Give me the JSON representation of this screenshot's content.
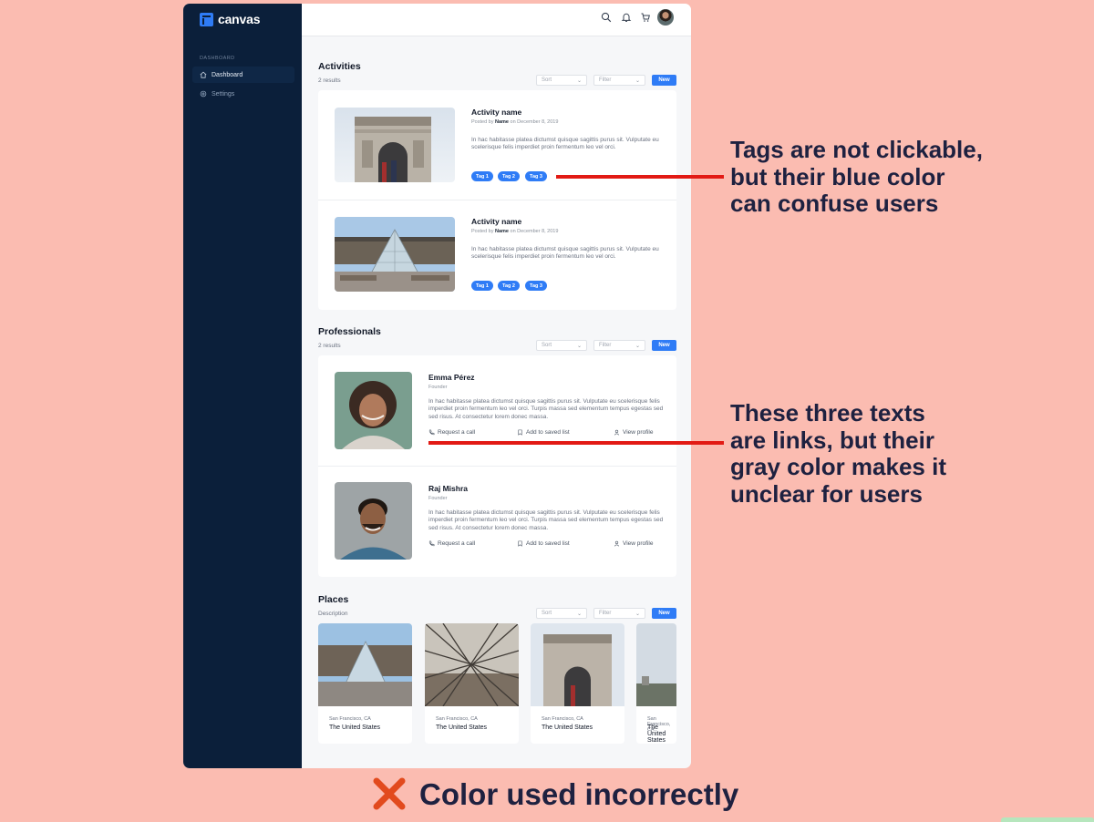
{
  "app": {
    "logo": "canvas",
    "nav_section": "DASHBOARD",
    "nav_items": [
      {
        "label": "Dashboard",
        "active": true,
        "icon": "home-icon"
      },
      {
        "label": "Settings",
        "active": false,
        "icon": "gear-icon"
      }
    ],
    "top_icons": [
      "search-icon",
      "bell-icon",
      "cart-icon",
      "avatar"
    ]
  },
  "controls": {
    "sort": "Sort",
    "filter": "Filter",
    "new": "New"
  },
  "activities": {
    "title": "Activities",
    "count": "2 results",
    "items": [
      {
        "title": "Activity name",
        "posted_by": "Posted by",
        "author": "Name",
        "date_prefix": "on",
        "date": "December 8, 2019",
        "body": "In hac habitasse platea dictumst quisque sagittis purus sit. Vulputate eu scelerisque felis imperdiet proin fermentum leo vel orci.",
        "tags": [
          "Tag 1",
          "Tag 2",
          "Tag 3"
        ],
        "image": "arc-de-triomphe"
      },
      {
        "title": "Activity name",
        "posted_by": "Posted by",
        "author": "Name",
        "date_prefix": "on",
        "date": "December 8, 2019",
        "body": "In hac habitasse platea dictumst quisque sagittis purus sit. Vulputate eu scelerisque felis imperdiet proin fermentum leo vel orci.",
        "tags": [
          "Tag 1",
          "Tag 2",
          "Tag 3"
        ],
        "image": "louvre-pyramid"
      }
    ]
  },
  "professionals": {
    "title": "Professionals",
    "count": "2 results",
    "items": [
      {
        "name": "Emma Pérez",
        "role": "Founder",
        "body": "In hac habitasse platea dictumst quisque sagittis purus sit. Vulputate eu scelerisque felis imperdiet proin fermentum leo vel orci. Turpis massa sed elementum tempus egestas sed sed risus. At consectetur lorem donec massa.",
        "links": [
          "Request a call",
          "Add to saved list",
          "View profile"
        ]
      },
      {
        "name": "Raj Mishra",
        "role": "Founder",
        "body": "In hac habitasse platea dictumst quisque sagittis purus sit. Vulputate eu scelerisque felis imperdiet proin fermentum leo vel orci. Turpis massa sed elementum tempus egestas sed sed risus. At consectetur lorem donec massa.",
        "links": [
          "Request a call",
          "Add to saved list",
          "View profile"
        ]
      }
    ]
  },
  "places": {
    "title": "Places",
    "description": "Description",
    "items": [
      {
        "city": "San Francisco, CA",
        "country": "The United States",
        "image": "louvre-pyramid"
      },
      {
        "city": "San Francisco, CA",
        "country": "The United States",
        "image": "eiffel-tower-view"
      },
      {
        "city": "San Francisco, CA",
        "country": "The United States",
        "image": "arc-de-triomphe"
      },
      {
        "city": "San Francisco, CA",
        "country": "The United States",
        "image": "paris-skyline"
      }
    ]
  },
  "annotations": {
    "tags_note": [
      "Tags are not clickable,",
      "but their blue color",
      "can confuse users"
    ],
    "links_note": [
      "These three texts",
      "are links, but their",
      "gray color makes it",
      "unclear for users"
    ],
    "verdict": "Color used incorrectly",
    "verdict_icon": "cross-icon"
  },
  "colors": {
    "background": "#fbbcb1",
    "sidebar": "#0b1f3a",
    "accent": "#2f7cf6",
    "annotation_line": "#e21a14",
    "annotation_text": "#1e2140"
  }
}
